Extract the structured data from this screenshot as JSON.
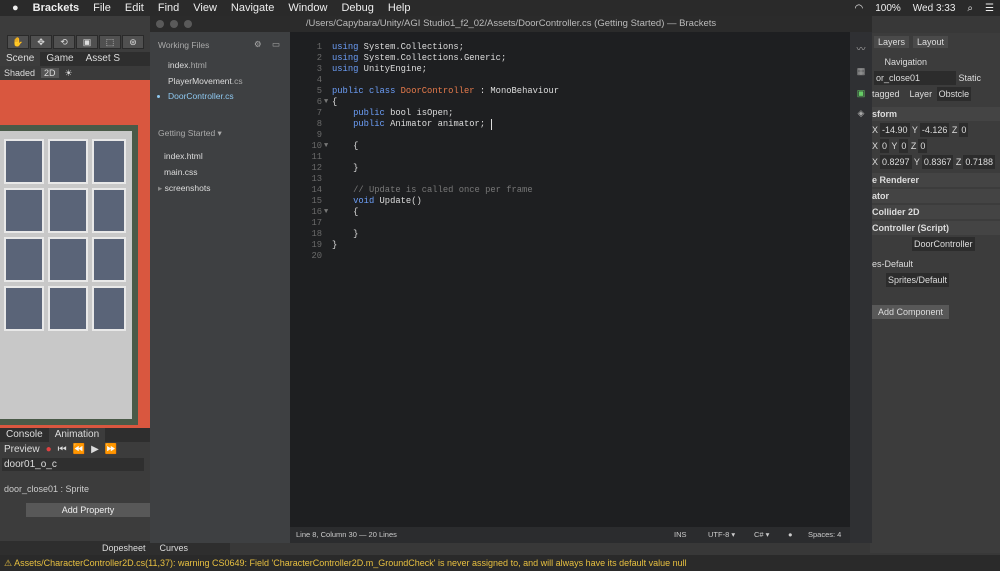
{
  "menubar": {
    "apple": "",
    "app": "Brackets",
    "items": [
      "File",
      "Edit",
      "Find",
      "View",
      "Navigate",
      "Window",
      "Debug",
      "Help"
    ],
    "battery": "100%",
    "clock": "Wed 3:33"
  },
  "unity": {
    "tools": [
      "✋",
      "✥",
      "⟲",
      "▣",
      "⬚",
      "⊛"
    ],
    "scene_tabs": [
      "Scene",
      "Game",
      "Asset S"
    ],
    "shading": "Shaded",
    "mode_2d": "2D",
    "anim_tabs": [
      "Console",
      "Animation"
    ],
    "preview": "Preview",
    "clip": "door01_o_c",
    "sprite_row": "door_close01 : Sprite",
    "add_property": "Add Property",
    "dope_tabs": [
      "Dopesheet",
      "Curves"
    ],
    "warning": "Assets/CharacterController2D.cs(11,37): warning CS0649: Field 'CharacterController2D.m_GroundCheck' is never assigned to, and will always have its default value null"
  },
  "inspector": {
    "layers": "Layers",
    "layout": "Layout",
    "navigation": "Navigation",
    "object_name": "or_close01",
    "static": "Static",
    "tag": "tagged",
    "layer_label": "Layer",
    "layer_value": "Obstcle",
    "transform": "sform",
    "pos": {
      "x": "-14.90",
      "y": "-4.126",
      "z": "0"
    },
    "rot": {
      "x": "0",
      "y": "0",
      "z": "0"
    },
    "scale": {
      "x": "0.8297",
      "y": "0.8367",
      "z": "0.7188"
    },
    "components": [
      "e Renderer",
      "ator",
      "Collider 2D",
      "Controller (Script)"
    ],
    "script_ref": "DoorController",
    "material": "es-Default",
    "shader": "Sprites/Default",
    "add_component": "Add Component"
  },
  "brackets": {
    "title": "/Users/Capybara/Unity/AGI Studio1_f2_02/Assets/DoorController.cs (Getting Started) — Brackets",
    "working_files_label": "Working Files",
    "working_files": [
      {
        "name": "index",
        "ext": ".html"
      },
      {
        "name": "PlayerMovement",
        "ext": ".cs"
      },
      {
        "name": "DoorController",
        "ext": ".cs"
      }
    ],
    "project_label": "Getting Started",
    "project_files": [
      {
        "name": "index",
        "ext": ".html"
      },
      {
        "name": "main",
        "ext": ".css"
      },
      {
        "name": "screenshots",
        "ext": ""
      }
    ],
    "code_lines": [
      "using System.Collections;",
      "using System.Collections.Generic;",
      "using UnityEngine;",
      "",
      "public class DoorController : MonoBehaviour",
      "{",
      "    public bool isOpen;",
      "    public Animator animator;",
      "",
      "    {",
      "",
      "    }",
      "",
      "    // Update is called once per frame",
      "    void Update()",
      "    {",
      "",
      "    }",
      "}",
      ""
    ],
    "status": {
      "position": "Line 8, Column 30 — 20 Lines",
      "ins": "INS",
      "encoding": "UTF-8",
      "language": "C#",
      "spaces": "Spaces: 4"
    }
  }
}
